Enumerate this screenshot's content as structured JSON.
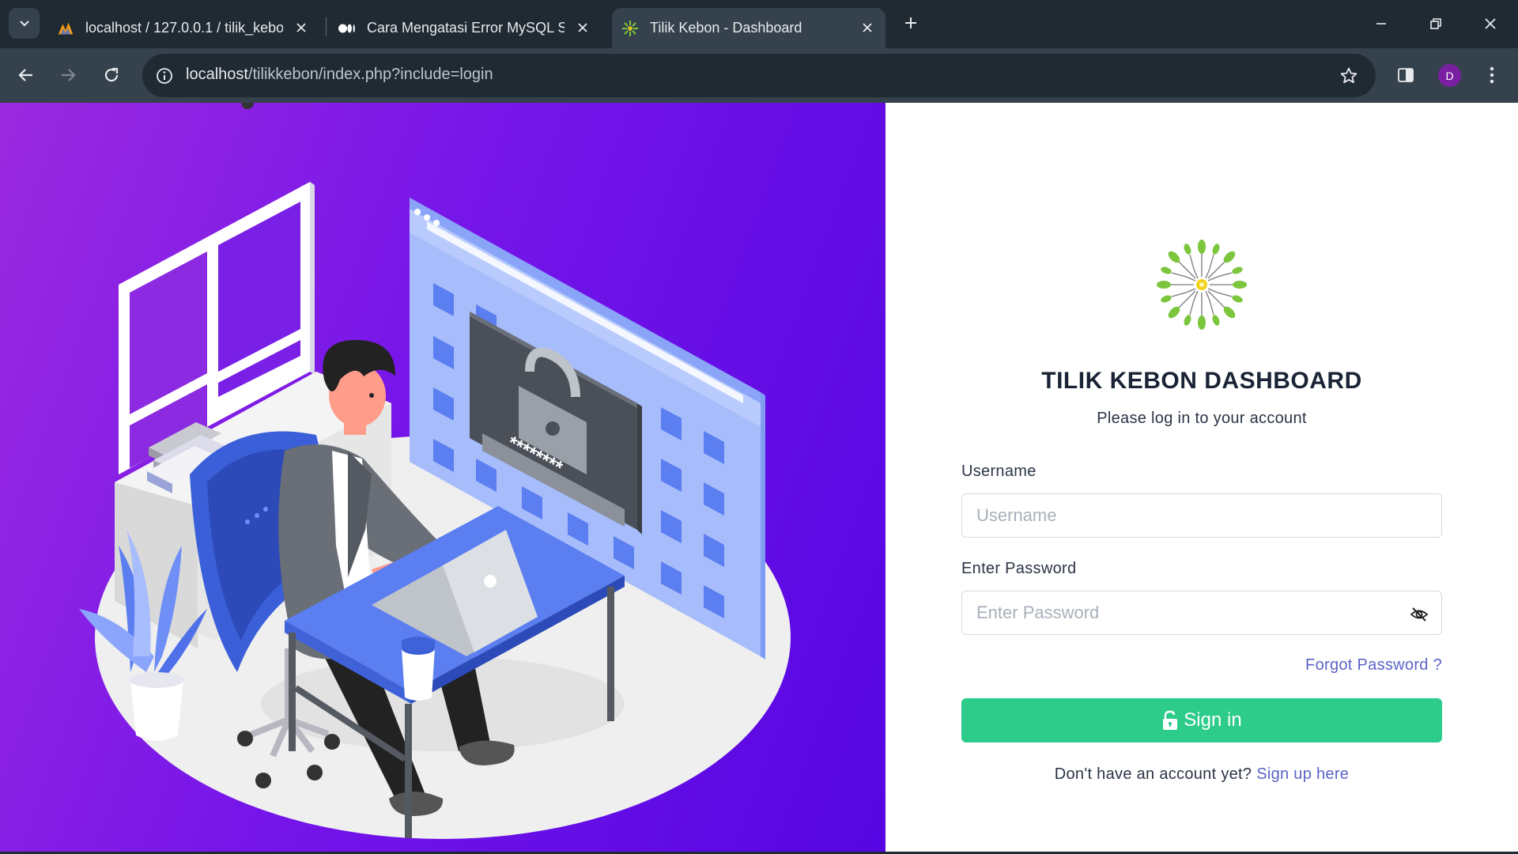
{
  "browser": {
    "tabs": [
      {
        "title": "localhost / 127.0.0.1 / tilik_kebo",
        "favicon": "phpmyadmin-icon"
      },
      {
        "title": "Cara Mengatasi Error MySQL Sh",
        "favicon": "medium-icon"
      },
      {
        "title": "Tilik Kebon - Dashboard",
        "favicon": "tilik-kebon-icon",
        "active": true
      }
    ],
    "url_host": "localhost",
    "url_path": "/tilikkebon/index.php?include=login",
    "profile_initial": "D"
  },
  "login": {
    "title": "TILIK KEBON DASHBOARD",
    "subtitle": "Please log in to your account",
    "username_label": "Username",
    "username_placeholder": "Username",
    "password_label": "Enter Password",
    "password_placeholder": "Enter Password",
    "forgot_text": "Forgot Password ?",
    "signin_text": "Sign in",
    "no_account_text": "Don't have an account yet?",
    "signup_text": "Sign up here"
  },
  "colors": {
    "accent_green": "#2ecc8b",
    "link": "#5b63c7",
    "hero_gradient_start": "#9b2ae0",
    "hero_gradient_end": "#5506e2"
  },
  "illustration": {
    "lock_screen_text": "********"
  }
}
